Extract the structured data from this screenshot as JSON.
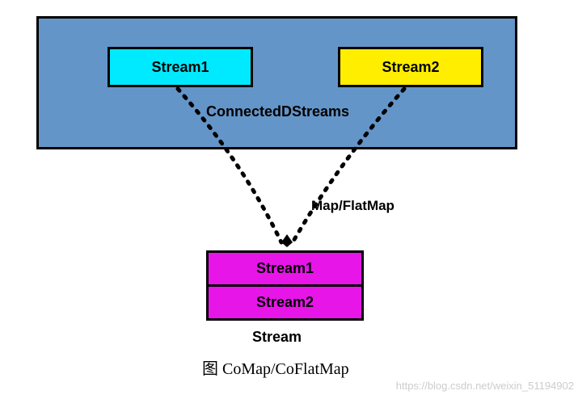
{
  "top": {
    "stream1": "Stream1",
    "stream2": "Stream2",
    "connected": "ConnectedDStreams"
  },
  "arrow_label": "Map/FlatMap",
  "output": {
    "stream1": "Stream1",
    "stream2": "Stream2",
    "label": "Stream"
  },
  "caption": "图 CoMap/CoFlatMap",
  "watermark": "https://blog.csdn.net/weixin_51194902"
}
